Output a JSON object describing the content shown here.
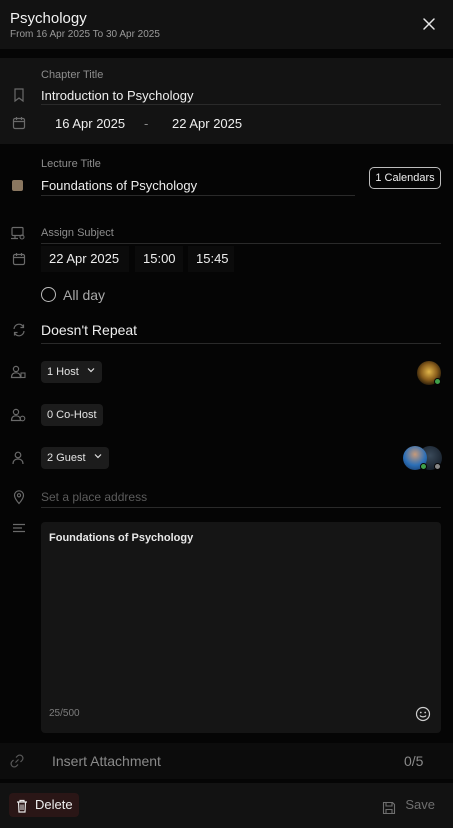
{
  "header": {
    "title": "Psychology",
    "subtitle": "From 16 Apr 2025 To 30 Apr 2025"
  },
  "chapter": {
    "label": "Chapter Title",
    "value": "Introduction to Psychology",
    "start_date": "16 Apr 2025",
    "separator": "-",
    "end_date": "22 Apr 2025"
  },
  "lecture": {
    "label": "Lecture Title",
    "value": "Foundations of Psychology",
    "calendars_button": "1 Calendars",
    "color_swatch": "#8a7760"
  },
  "subject": {
    "label": "Assign Subject",
    "date": "22 Apr 2025",
    "start_time": "15:00",
    "end_time": "15:45"
  },
  "all_day": {
    "label": "All day"
  },
  "repeat": {
    "value": "Doesn't Repeat"
  },
  "host": {
    "label": "1 Host"
  },
  "cohost": {
    "label": "0 Co-Host"
  },
  "guest": {
    "label": "2 Guest"
  },
  "place": {
    "placeholder": "Set a place address"
  },
  "description": {
    "text": "Foundations of Psychology",
    "counter": "25/500"
  },
  "attachment": {
    "label": "Insert Attachment",
    "count": "0/5"
  },
  "footer": {
    "delete_label": "Delete",
    "save_label": "Save"
  },
  "colors": {
    "background": "#050505",
    "panel": "#131313",
    "online": "#3fa04a",
    "offline": "#888888",
    "delete_bg": "#2a1616"
  }
}
